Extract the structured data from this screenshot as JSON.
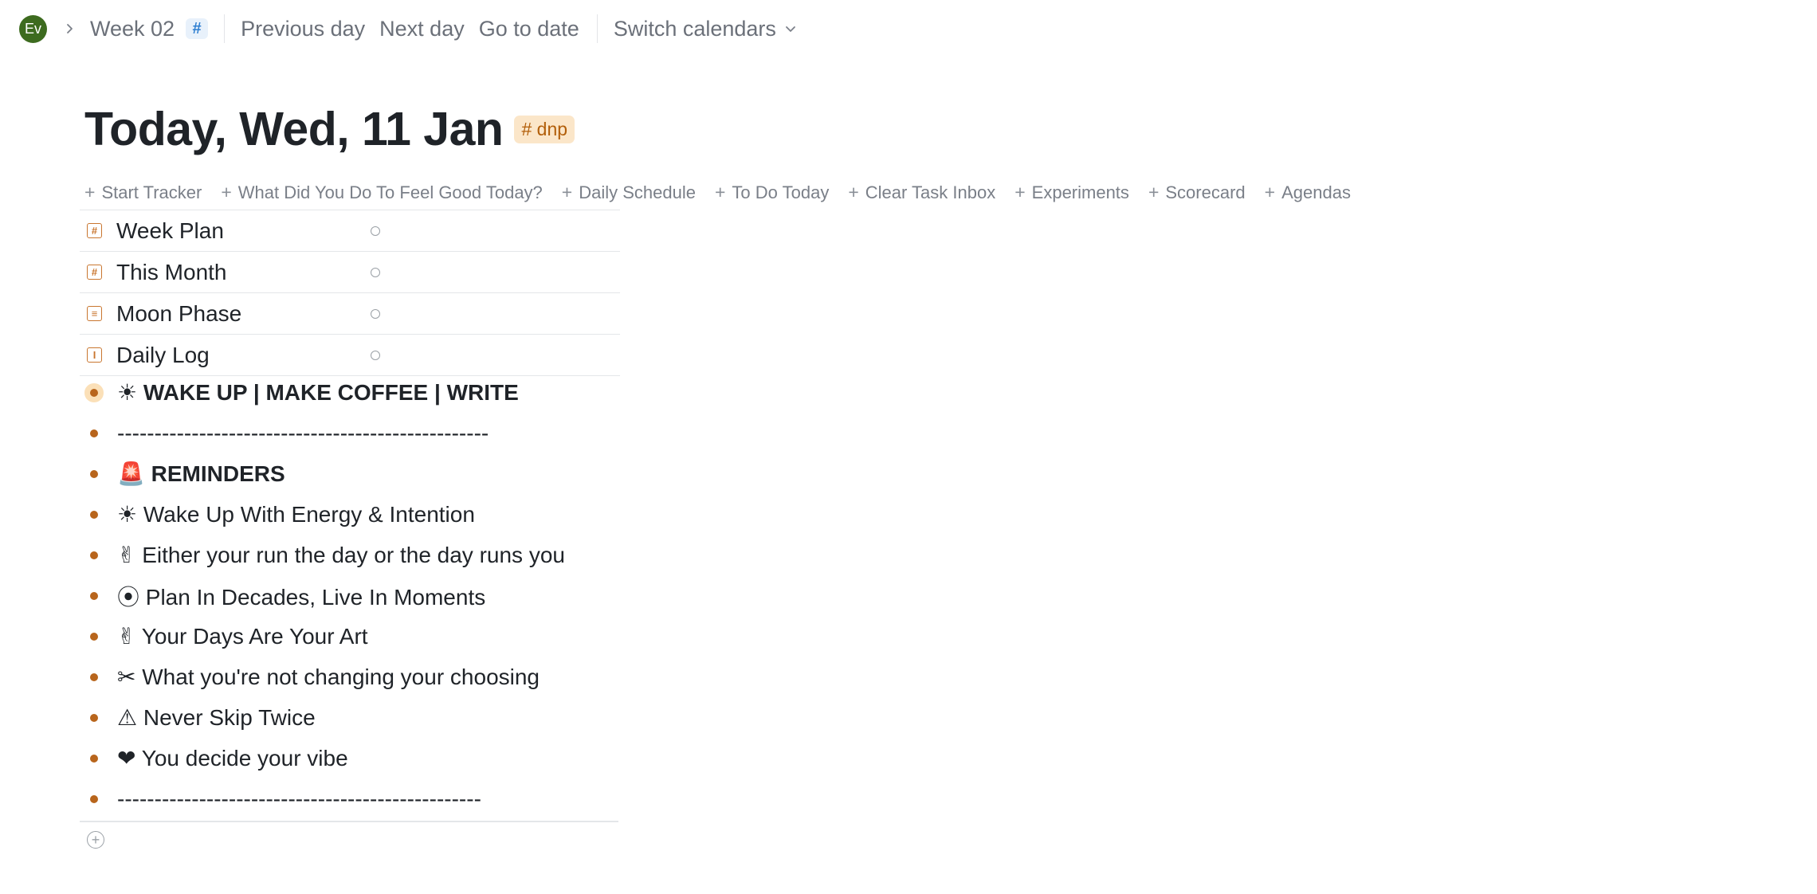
{
  "topbar": {
    "avatar_initials": "Ev",
    "breadcrumb_week": "Week 02",
    "hash_badge": "#",
    "nav": [
      "Previous day",
      "Next day",
      "Go to date"
    ],
    "switch_calendars": "Switch calendars"
  },
  "page": {
    "title": "Today, Wed, 11 Jan",
    "tag": "# dnp"
  },
  "templates": [
    {
      "plus": "+",
      "label": "Start Tracker"
    },
    {
      "plus": "+",
      "label": "What Did You Do To Feel Good Today?"
    },
    {
      "plus": "+",
      "label": "Daily Schedule"
    },
    {
      "plus": "+",
      "label": "To Do Today"
    },
    {
      "plus": "+",
      "label": "Clear Task Inbox"
    },
    {
      "plus": "+",
      "label": "Experiments"
    },
    {
      "plus": "+",
      "label": "Scorecard"
    },
    {
      "plus": "+",
      "label": "Agendas"
    }
  ],
  "properties": [
    {
      "icon": "hash-icon",
      "glyph": "#",
      "label": "Week Plan"
    },
    {
      "icon": "hash-icon",
      "glyph": "#",
      "label": "This Month"
    },
    {
      "icon": "list-icon",
      "glyph": "≡",
      "label": "Moon Phase"
    },
    {
      "icon": "text-icon",
      "glyph": "I",
      "label": "Daily Log"
    }
  ],
  "blocks": [
    {
      "text": "☀ WAKE UP | MAKE COFFEE | WRITE",
      "bold": true,
      "focused": true
    },
    {
      "text": "--------------------------------------------------",
      "bold": false
    },
    {
      "text": "🚨 REMINDERS",
      "bold": true
    },
    {
      "text": "☀ Wake Up With Energy & Intention",
      "bold": false
    },
    {
      "text": "✌ Either your run the day or the day runs you",
      "bold": false
    },
    {
      "text": "⦿ Plan In Decades, Live In Moments",
      "bold": false
    },
    {
      "text": "✌ Your Days Are Your Art",
      "bold": false
    },
    {
      "text": "✂ What you're not changing your choosing",
      "bold": false
    },
    {
      "text": "⚠ Never Skip Twice",
      "bold": false
    },
    {
      "text": "❤ You decide your vibe",
      "bold": false
    },
    {
      "text": "-------------------------------------------------",
      "bold": false
    }
  ],
  "add_block_glyph": "+",
  "colors": {
    "accent_orange": "#b8651c",
    "tag_bg": "#fbe6c9",
    "avatar_green": "#3d6b1f",
    "muted_text": "#6b7079"
  }
}
